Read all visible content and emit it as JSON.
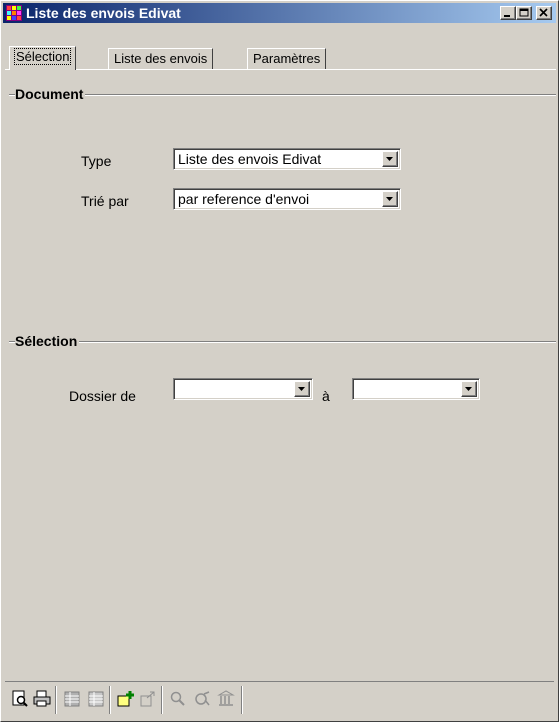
{
  "window": {
    "title": "Liste des envois Edivat",
    "controls": [
      "minimize",
      "maximize",
      "close"
    ]
  },
  "tabs": [
    {
      "label": "Sélection",
      "active": true
    },
    {
      "label": "Liste des envois",
      "active": false
    },
    {
      "label": "Paramètres",
      "active": false
    }
  ],
  "document_group": {
    "title": "Document",
    "type_label": "Type",
    "type_value": "Liste des envois Edivat",
    "sort_label": "Trié par",
    "sort_value": "par reference d'envoi"
  },
  "selection_group": {
    "title": "Sélection",
    "from_label": "Dossier  de",
    "from_value": "",
    "to_label": "à",
    "to_value": ""
  },
  "toolbar": {
    "icons": [
      "preview-icon",
      "print-icon",
      "grid-icon",
      "list-icon",
      "add-icon",
      "export-icon",
      "search-icon",
      "refresh-icon",
      "bank-icon"
    ]
  }
}
